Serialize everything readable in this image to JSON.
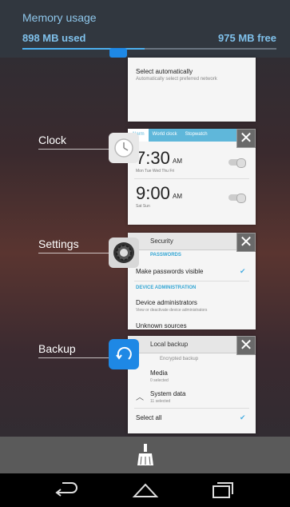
{
  "memory": {
    "title": "Memory usage",
    "used": "898 MB used",
    "free": "975 MB free",
    "used_fraction": 0.48
  },
  "recents": {
    "top_card": {
      "title": "Select automatically",
      "subtitle": "Automatically select preferred network"
    },
    "clock": {
      "label": "Clock",
      "tabs": [
        "Alarm",
        "World clock",
        "Stopwatch"
      ],
      "alarms": [
        {
          "time": "7:30",
          "ampm": "AM",
          "days": "Mon Tue Wed Thu Fri"
        },
        {
          "time": "9:00",
          "ampm": "AM",
          "days": "Sat Sun"
        }
      ]
    },
    "settings": {
      "label": "Settings",
      "header": "Security",
      "section1": "PASSWORDS",
      "row1": "Make passwords visible",
      "section2": "DEVICE ADMINISTRATION",
      "row2": "Device administrators",
      "row2_sub": "View or deactivate device administrators",
      "row3": "Unknown sources"
    },
    "backup": {
      "label": "Backup",
      "header": "Local backup",
      "encrypted": "Encrypted backup",
      "media": "Media",
      "media_sub": "0 selected",
      "system": "System data",
      "system_sub": "11 selected",
      "select_all": "Select all"
    }
  },
  "icons": {
    "clock": "clock-icon",
    "settings": "gear-icon",
    "backup": "backup-icon",
    "clear": "broom-icon",
    "back": "back-icon",
    "home": "home-icon",
    "recents": "recents-icon"
  },
  "colors": {
    "accent": "#4db0ef",
    "clock_tab": "#5fb7da",
    "backup_icon": "#1e88e5"
  }
}
